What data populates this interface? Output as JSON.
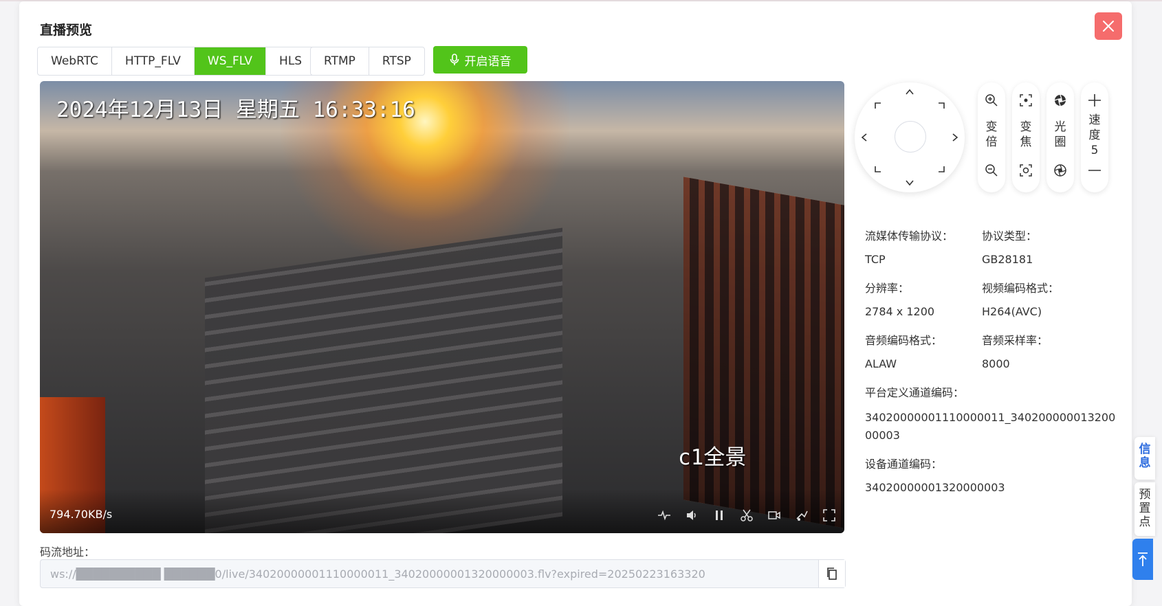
{
  "dialog": {
    "title": "直播预览"
  },
  "protocol_tabs": [
    {
      "label": "WebRTC"
    },
    {
      "label": "HTTP_FLV"
    },
    {
      "label": "WS_FLV"
    },
    {
      "label": "HLS"
    }
  ],
  "push_tabs": [
    {
      "label": "RTMP"
    },
    {
      "label": "RTSP"
    }
  ],
  "active_tab": "WS_FLV",
  "voice_button": {
    "label": "开启语音"
  },
  "video": {
    "osd_time": "2024年12月13日 星期五 16:33:16",
    "osd_channel": "c1全景",
    "bitrate": "794.70KB/s"
  },
  "stream": {
    "label": "码流地址：",
    "value": "ws://██████████ ██████0/live/34020000001110000011_34020000001320000003.flv?expired=20250223163320"
  },
  "ptz_pills": [
    {
      "label": "变倍"
    },
    {
      "label": "变焦"
    },
    {
      "label": "光圈"
    },
    {
      "label": "速度",
      "value": "5"
    }
  ],
  "info": {
    "transport_label": "流媒体传输协议：",
    "transport_value": "TCP",
    "protocol_type_label": "协议类型：",
    "protocol_type_value": "GB28181",
    "resolution_label": "分辨率：",
    "resolution_value": "2784 x 1200",
    "video_codec_label": "视频编码格式：",
    "video_codec_value": "H264(AVC)",
    "audio_codec_label": "音频编码格式：",
    "audio_codec_value": "ALAW",
    "sample_rate_label": "音频采样率：",
    "sample_rate_value": "8000",
    "platform_channel_label": "平台定义通道编码：",
    "platform_channel_value_line1": "34020000001110000011_340200000013200",
    "platform_channel_value_line2": "00003",
    "device_channel_label": "设备通道编码：",
    "device_channel_value": "34020000001320000003"
  },
  "side_tabs": {
    "info": "信息",
    "preset": "预置点"
  },
  "colors": {
    "accent_green": "#52c41a",
    "close_red": "#f56c6c",
    "side_blue": "#2f80ed"
  }
}
